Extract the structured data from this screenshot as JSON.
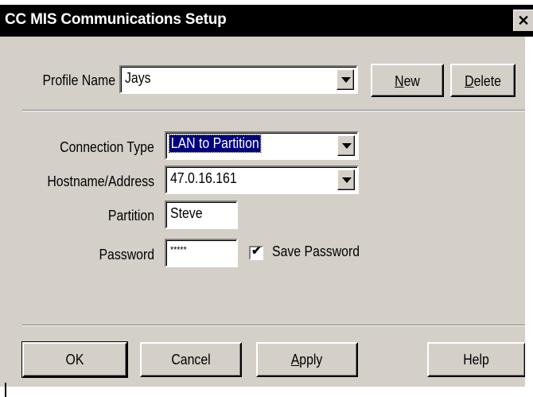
{
  "window": {
    "title": "CC MIS Communications Setup",
    "close_glyph": "✕",
    "close_icon": "close-icon"
  },
  "profile": {
    "label": "Profile Name",
    "value": "Jays"
  },
  "buttons_top": {
    "new": "New",
    "new_accel": "N",
    "delete": "Delete",
    "delete_accel": "D"
  },
  "connection": {
    "type_label": "Connection Type",
    "type_value": "LAN to Partition",
    "host_label": "Hostname/Address",
    "host_value": "47.0.16.161",
    "partition_label": "Partition",
    "partition_value": "Steve",
    "password_label": "Password",
    "password_value": "*****",
    "save_password_label": "Save Password",
    "save_password_checked": true,
    "checkmark": "✔"
  },
  "buttons_bottom": {
    "ok": "OK",
    "cancel": "Cancel",
    "apply": "Apply",
    "apply_accel": "A",
    "help": "Help"
  },
  "colors": {
    "face": "#d4d0c8",
    "titlebar": "#000000",
    "selection": "#000080"
  },
  "icons": {
    "dropdown": "chevron-down-icon",
    "checkbox": "checkbox-checked-icon"
  }
}
